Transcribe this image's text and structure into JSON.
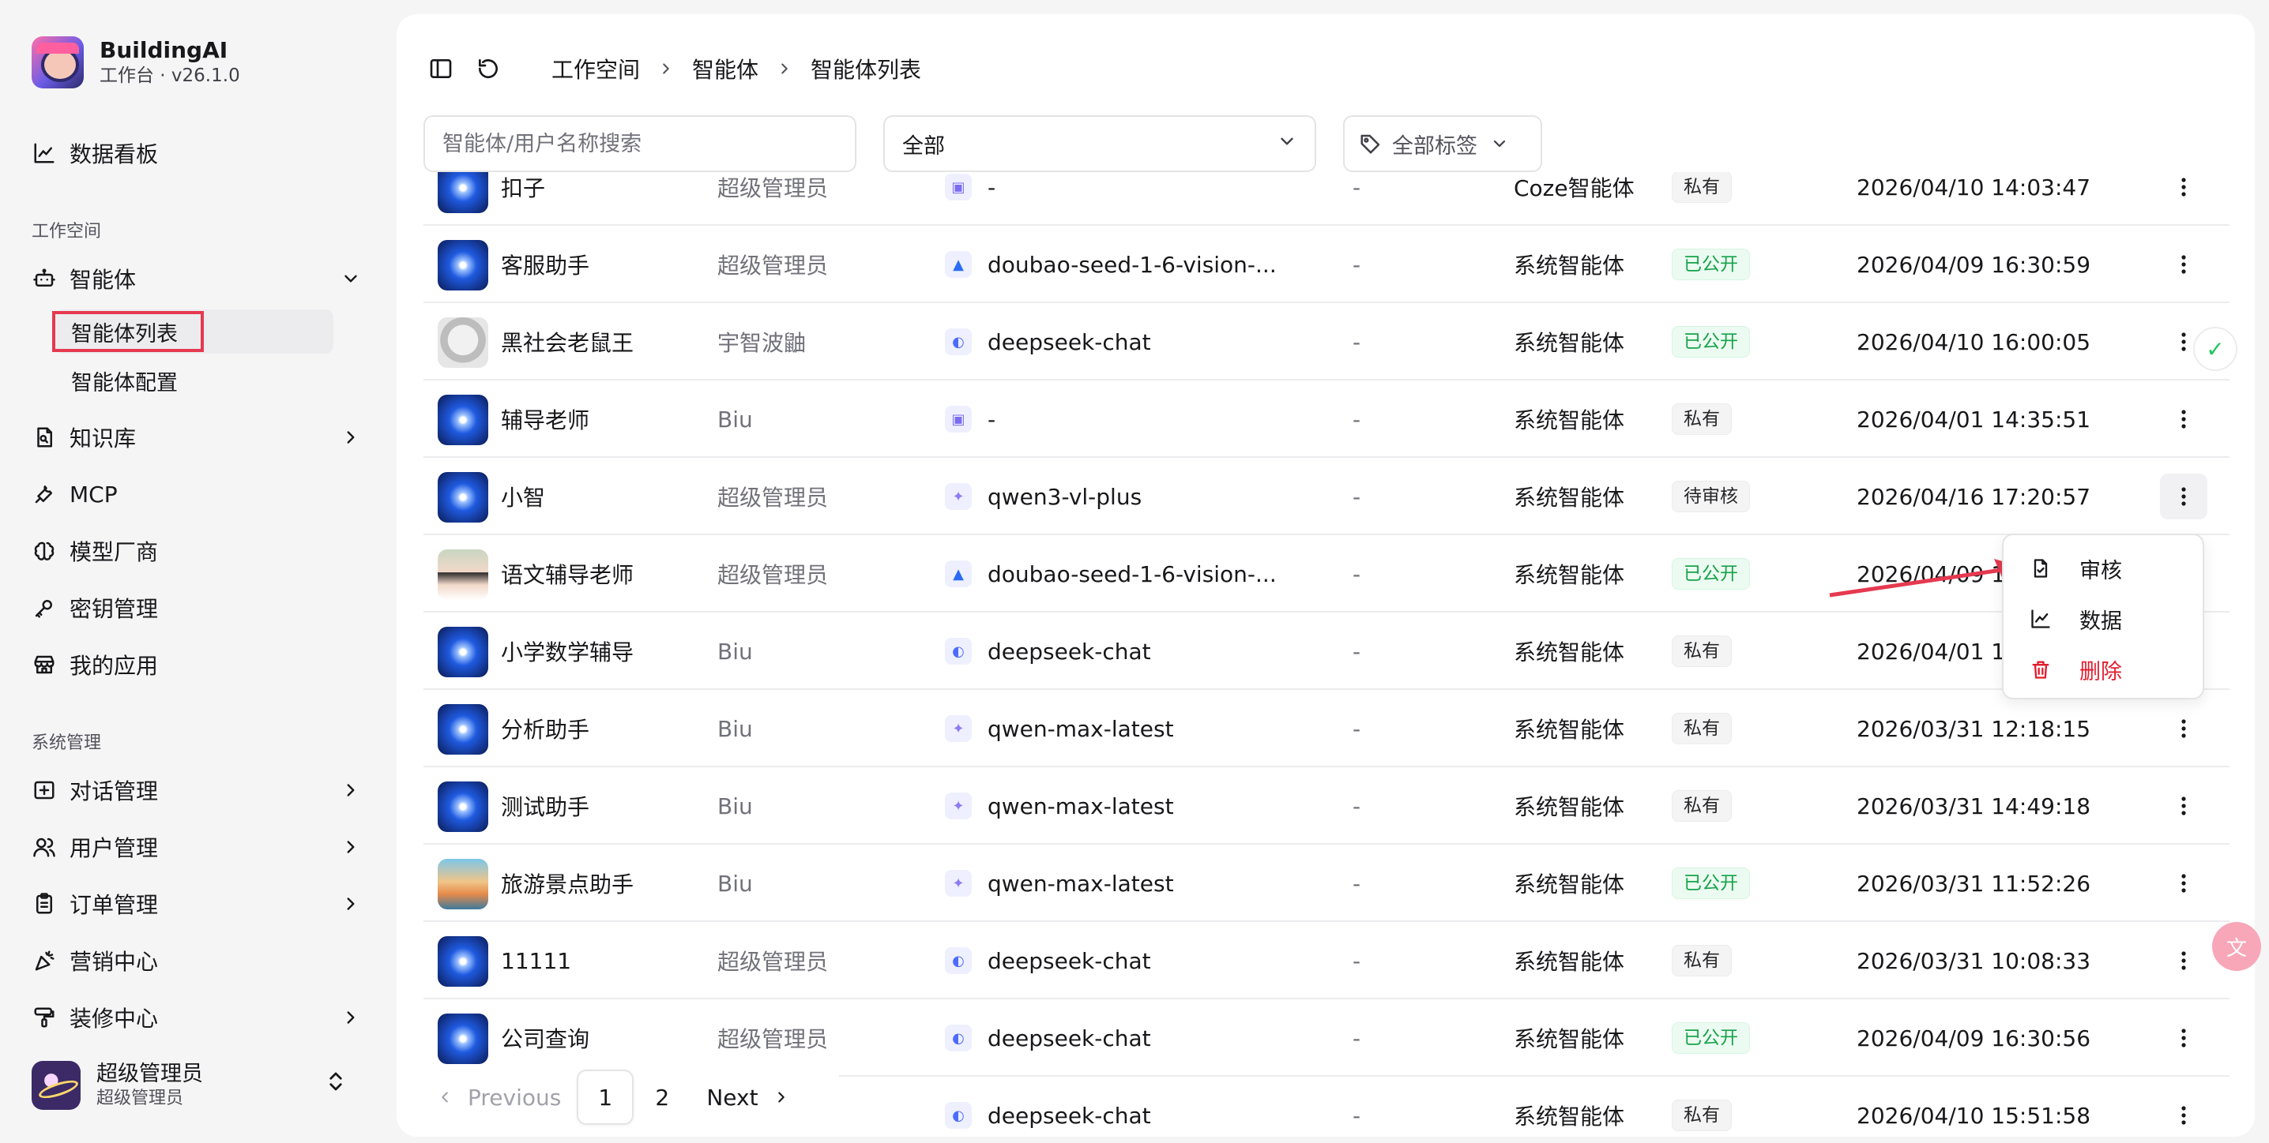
{
  "brand": {
    "name": "BuildingAI",
    "subtitle": "工作台 · v26.1.0"
  },
  "sidebar": {
    "dashboard": "数据看板",
    "section_workspace": "工作空间",
    "agents": "智能体",
    "agents_sub": [
      "智能体列表",
      "智能体配置"
    ],
    "knowledge": "知识库",
    "mcp": "MCP",
    "model_vendor": "模型厂商",
    "key_manage": "密钥管理",
    "my_apps": "我的应用",
    "section_system": "系统管理",
    "chat_manage": "对话管理",
    "user_manage": "用户管理",
    "order_manage": "订单管理",
    "marketing": "营销中心",
    "decoration": "装修中心"
  },
  "user": {
    "name": "超级管理员",
    "role": "超级管理员"
  },
  "breadcrumb": [
    "工作空间",
    "智能体",
    "智能体列表"
  ],
  "filters": {
    "search_placeholder": "智能体/用户名称搜索",
    "status_selected": "全部",
    "tags_label": "全部标签"
  },
  "rows": [
    {
      "name": "扣子",
      "owner": "超级管理员",
      "model": "-",
      "model_icon": "robot-icon",
      "dash": "-",
      "type": "Coze智能体",
      "status": "私有",
      "status_kind": "private",
      "date": "2026/04/10 14:03:47",
      "avatar": "star"
    },
    {
      "name": "客服助手",
      "owner": "超级管理员",
      "model": "doubao-seed-1-6-vision-...",
      "model_icon": "doubao-icon",
      "dash": "-",
      "type": "系统智能体",
      "status": "已公开",
      "status_kind": "public",
      "date": "2026/04/09 16:30:59",
      "avatar": "star"
    },
    {
      "name": "黑社会老鼠王",
      "owner": "宇智波鼬",
      "model": "deepseek-chat",
      "model_icon": "deepseek-icon",
      "dash": "-",
      "type": "系统智能体",
      "status": "已公开",
      "status_kind": "public",
      "date": "2026/04/10 16:00:05",
      "avatar": "rat"
    },
    {
      "name": "辅导老师",
      "owner": "Biu",
      "model": "-",
      "model_icon": "robot-icon",
      "dash": "-",
      "type": "系统智能体",
      "status": "私有",
      "status_kind": "private",
      "date": "2026/04/01 14:35:51",
      "avatar": "star"
    },
    {
      "name": "小智",
      "owner": "超级管理员",
      "model": "qwen3-vl-plus",
      "model_icon": "qwen-icon",
      "dash": "-",
      "type": "系统智能体",
      "status": "待审核",
      "status_kind": "pending",
      "date": "2026/04/16 17:20:57",
      "avatar": "star"
    },
    {
      "name": "语文辅导老师",
      "owner": "超级管理员",
      "model": "doubao-seed-1-6-vision-...",
      "model_icon": "doubao-icon",
      "dash": "-",
      "type": "系统智能体",
      "status": "已公开",
      "status_kind": "public",
      "date": "2026/04/09 1",
      "avatar": "girl"
    },
    {
      "name": "小学数学辅导",
      "owner": "Biu",
      "model": "deepseek-chat",
      "model_icon": "deepseek-icon",
      "dash": "-",
      "type": "系统智能体",
      "status": "私有",
      "status_kind": "private",
      "date": "2026/04/01 1",
      "avatar": "star"
    },
    {
      "name": "分析助手",
      "owner": "Biu",
      "model": "qwen-max-latest",
      "model_icon": "qwen-icon",
      "dash": "-",
      "type": "系统智能体",
      "status": "私有",
      "status_kind": "private",
      "date": "2026/03/31 12:18:15",
      "avatar": "star"
    },
    {
      "name": "测试助手",
      "owner": "Biu",
      "model": "qwen-max-latest",
      "model_icon": "qwen-icon",
      "dash": "-",
      "type": "系统智能体",
      "status": "私有",
      "status_kind": "private",
      "date": "2026/03/31 14:49:18",
      "avatar": "star"
    },
    {
      "name": "旅游景点助手",
      "owner": "Biu",
      "model": "qwen-max-latest",
      "model_icon": "qwen-icon",
      "dash": "-",
      "type": "系统智能体",
      "status": "已公开",
      "status_kind": "public",
      "date": "2026/03/31 11:52:26",
      "avatar": "travel"
    },
    {
      "name": "11111",
      "owner": "超级管理员",
      "model": "deepseek-chat",
      "model_icon": "deepseek-icon",
      "dash": "-",
      "type": "系统智能体",
      "status": "私有",
      "status_kind": "private",
      "date": "2026/03/31 10:08:33",
      "avatar": "star"
    },
    {
      "name": "公司查询",
      "owner": "超级管理员",
      "model": "deepseek-chat",
      "model_icon": "deepseek-icon",
      "dash": "-",
      "type": "系统智能体",
      "status": "已公开",
      "status_kind": "public",
      "date": "2026/04/09 16:30:56",
      "avatar": "star"
    },
    {
      "name": "",
      "owner": "",
      "model": "deepseek-chat",
      "model_icon": "deepseek-icon",
      "dash": "-",
      "type": "系统智能体",
      "status": "私有",
      "status_kind": "private",
      "date": "2026/04/10 15:51:58",
      "avatar": "none"
    }
  ],
  "pagination": {
    "prev": "Previous",
    "pages": [
      "1",
      "2"
    ],
    "current": "1",
    "next": "Next"
  },
  "row_menu": {
    "items": [
      "审核",
      "数据",
      "删除"
    ]
  },
  "colors": {
    "accent_public": "#16a34a",
    "danger": "#e11d2e",
    "highlight": "#e53950"
  }
}
